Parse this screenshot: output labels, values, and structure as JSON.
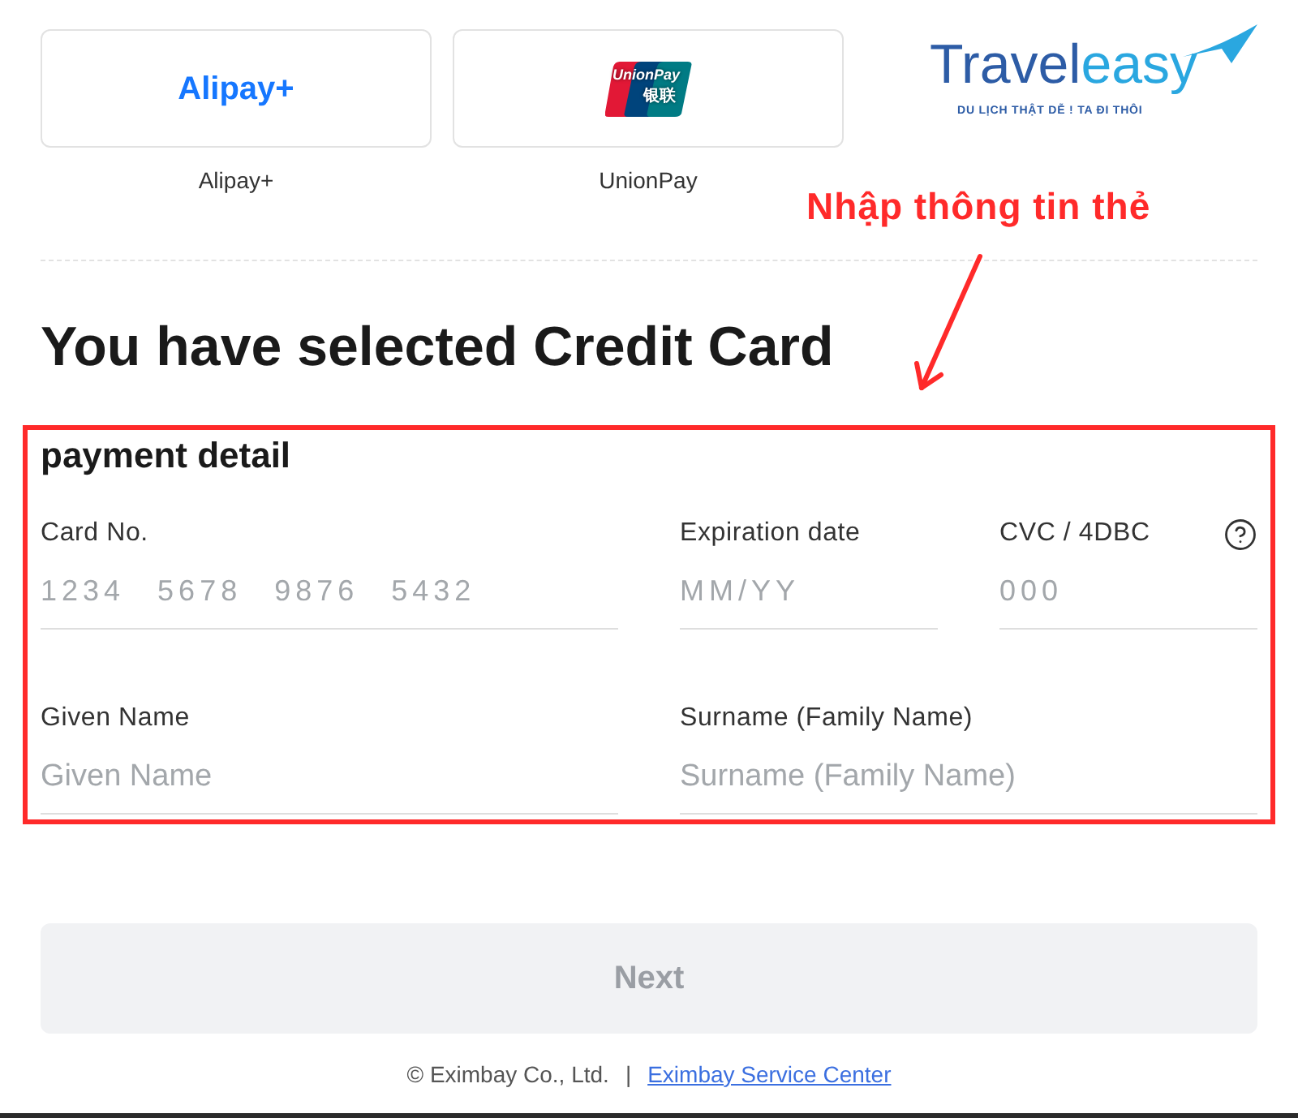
{
  "payment_methods": [
    {
      "kind": "alipay",
      "logo_text": "Alipay+",
      "label": "Alipay+"
    },
    {
      "kind": "unionpay",
      "logo_text": "UnionPay",
      "logo_text_2": "银联",
      "label": "UnionPay"
    }
  ],
  "brand_logo": {
    "word_1": "Travel",
    "word_2": "easy",
    "tagline": "DU LỊCH THẬT DỄ ! TA ĐI THÔI"
  },
  "annotation": {
    "text": "Nhập thông tin thẻ"
  },
  "heading": "You have selected Credit Card",
  "payment_detail": {
    "title": "payment detail",
    "rows": [
      {
        "fields": [
          {
            "kind": "card_number",
            "label": "Card No.",
            "placeholder": "1234 5678 9876 5432"
          },
          {
            "kind": "expiry",
            "label": "Expiration date",
            "placeholder": "MM/YY"
          },
          {
            "kind": "cvc",
            "label": "CVC / 4DBC",
            "placeholder": "000",
            "has_help": true
          }
        ]
      },
      {
        "fields": [
          {
            "kind": "name",
            "label": "Given Name",
            "placeholder": "Given Name"
          },
          {
            "kind": "name",
            "label": "Surname (Family Name)",
            "placeholder": "Surname (Family Name)"
          }
        ]
      }
    ]
  },
  "next_button": {
    "label": "Next",
    "disabled": true
  },
  "footer": {
    "copyright": "© Eximbay Co., Ltd.",
    "separator": "|",
    "link": "Eximbay Service Center"
  }
}
